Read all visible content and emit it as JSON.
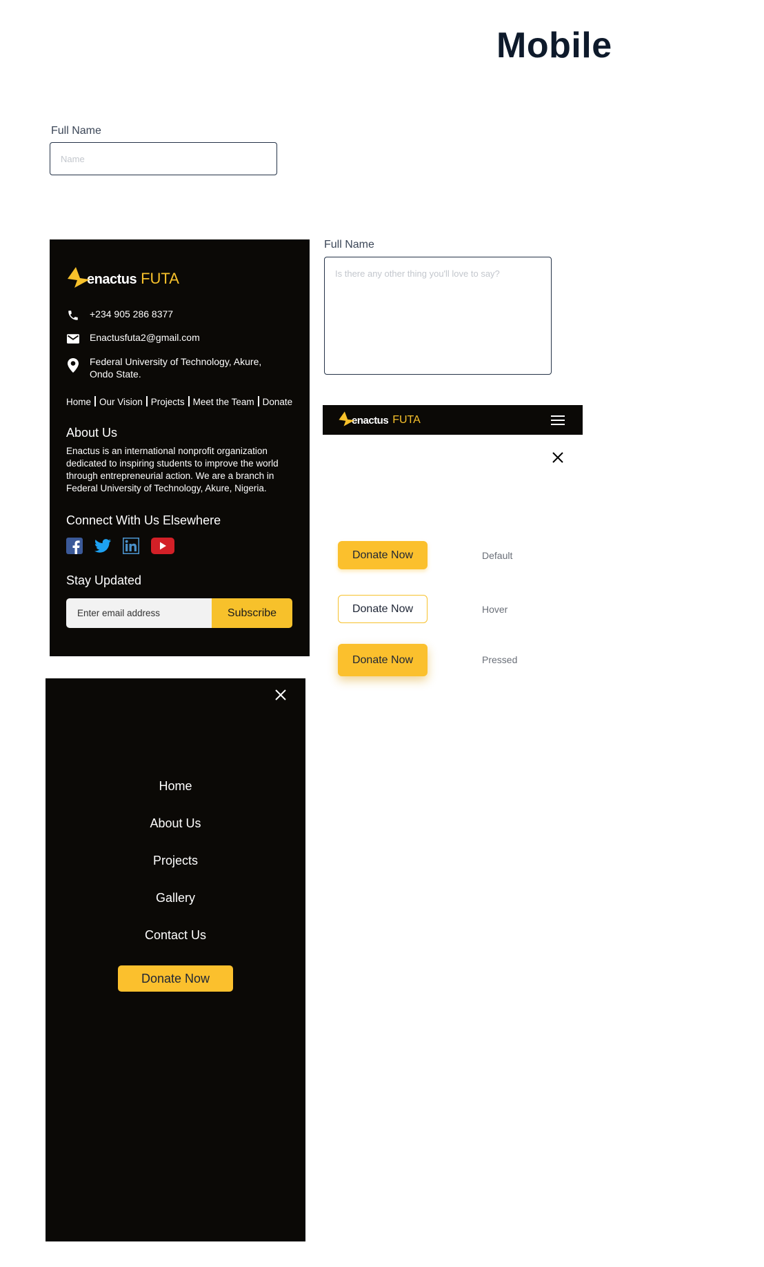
{
  "heading": "Mobile",
  "input_field": {
    "label": "Full Name",
    "placeholder": "Name"
  },
  "textarea_field": {
    "label": "Full Name",
    "placeholder": "Is there any other thing you'll love to say?"
  },
  "brand": {
    "word": "enactus",
    "accent": "FUTA",
    "accent_color": "#f7c12b"
  },
  "footer": {
    "phone": "+234 905 286 8377",
    "email": "Enactusfuta2@gmail.com",
    "address_line1": "Federal University of Technology, Akure,",
    "address_line2": "Ondo State.",
    "links": [
      "Home",
      "Our Vision",
      "Projects",
      "Meet the Team",
      "Donate"
    ],
    "about_title": "About Us",
    "about_text": "Enactus is an international nonprofit organization dedicated to inspiring students to improve the world through entrepreneurial action. We are a branch in Federal University of Technology, Akure, Nigeria.",
    "connect_title": "Connect With Us Elsewhere",
    "social_icons": [
      "facebook-icon",
      "twitter-icon",
      "linkedin-icon",
      "youtube-icon"
    ],
    "stay_title": "Stay Updated",
    "email_placeholder": "Enter email address",
    "subscribe_label": "Subscribe"
  },
  "button_states": [
    {
      "label": "Donate Now",
      "state": "Default"
    },
    {
      "label": "Donate Now",
      "state": "Hover"
    },
    {
      "label": "Donate Now",
      "state": "Pressed"
    }
  ],
  "menu": {
    "items": [
      "Home",
      "About Us",
      "Projects",
      "Gallery",
      "Contact Us"
    ],
    "donate_label": "Donate Now"
  },
  "colors": {
    "dark": "#0b0906",
    "yellow": "#fbc02d",
    "navy": "#0e1a2b"
  }
}
